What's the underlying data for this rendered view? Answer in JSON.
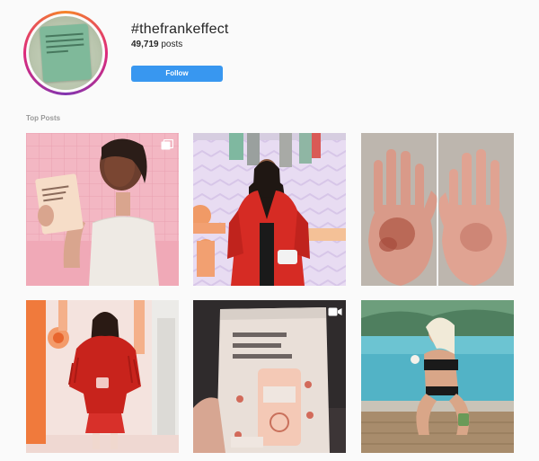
{
  "hashtag": "#thefrankeffect",
  "post_count": "49,719",
  "post_count_suffix": " posts",
  "follow_label": "Follow",
  "section_label": "Top Posts",
  "colors": {
    "follow_button": "#3897f0",
    "ring_gradient": [
      "#f58529",
      "#dd2a7b",
      "#8134af"
    ]
  },
  "posts": [
    {
      "name": "post-1",
      "icon": "multiple-images-icon"
    },
    {
      "name": "post-2"
    },
    {
      "name": "post-3"
    },
    {
      "name": "post-4"
    },
    {
      "name": "post-5",
      "icon": "video-icon"
    },
    {
      "name": "post-6"
    }
  ]
}
